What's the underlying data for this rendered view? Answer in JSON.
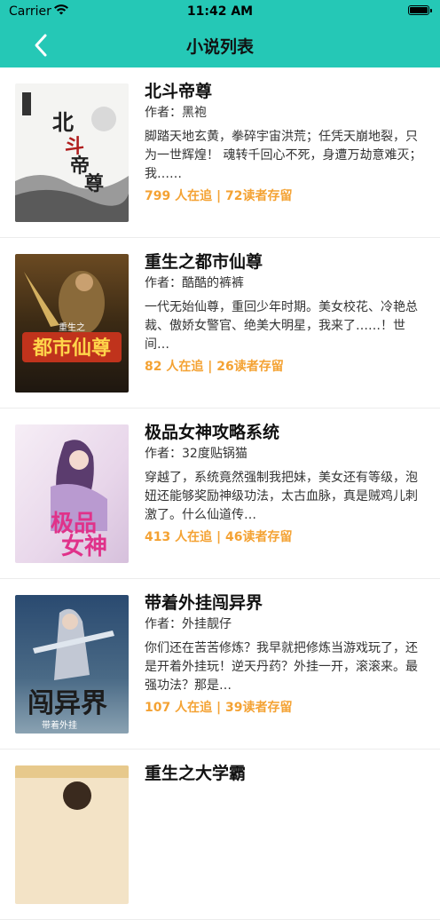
{
  "status_bar": {
    "carrier": "Carrier",
    "time": "11:42 AM"
  },
  "nav": {
    "title": "小说列表",
    "back_icon": "chevron-left-icon"
  },
  "colors": {
    "header": "#25c8b6",
    "accent": "#f4a233"
  },
  "author_prefix": "作者：",
  "books": [
    {
      "title": "北斗帝尊",
      "author": "黑袍",
      "desc": "脚踏天地玄黄，拳碎宇宙洪荒；任凭天崩地裂，只为一世辉煌！ 魂转千回心不死，身遭万劫意难灭；我……",
      "stats": "799 人在追 | 72读者存留",
      "cover_text": "北斗帝尊"
    },
    {
      "title": "重生之都市仙尊",
      "author": "酷酷的裤裤",
      "desc": "一代无始仙尊，重回少年时期。美女校花、冷艳总裁、傲娇女警官、绝美大明星，我来了……！世间…",
      "stats": "82 人在追 | 26读者存留",
      "cover_text": "都市仙尊"
    },
    {
      "title": "极品女神攻略系统",
      "author": "32度贴锅猫",
      "desc": "穿越了，系统竟然强制我把妹，美女还有等级，泡妞还能够奖励神级功法，太古血脉，真是贼鸡儿刺激了。什么仙道传…",
      "stats": "413 人在追 | 46读者存留",
      "cover_text": "极品女神"
    },
    {
      "title": "带着外挂闯异界",
      "author": "外挂靓仔",
      "desc": "你们还在苦苦修炼？我早就把修炼当游戏玩了，还是开着外挂玩！逆天丹药？外挂一开，滚滚来。最强功法？那是…",
      "stats": "107 人在追 | 39读者存留",
      "cover_text": "闯异界"
    },
    {
      "title": "重生之大学霸",
      "author": "",
      "desc": "",
      "stats": "",
      "cover_text": ""
    }
  ]
}
